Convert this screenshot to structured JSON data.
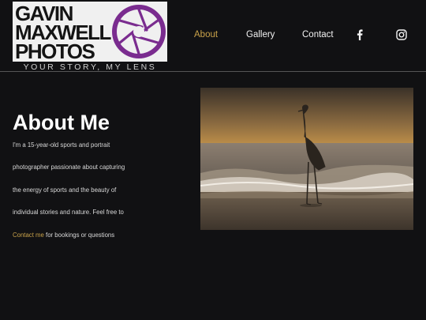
{
  "logo": {
    "lines": [
      "GAVIN",
      "MAXWELL",
      "PHOTOS"
    ],
    "tagline": "YOUR STORY, MY LENS",
    "accent_color": "#7a2c8f"
  },
  "nav": {
    "items": [
      {
        "label": "About",
        "active": true
      },
      {
        "label": "Gallery",
        "active": false
      },
      {
        "label": "Contact",
        "active": false
      }
    ],
    "active_color": "#c9a24a",
    "social_icons": [
      "facebook-icon",
      "instagram-icon"
    ]
  },
  "main": {
    "title": "About Me",
    "bio_prefix": "I'm a 15-year-old sports and portrait photographer passionate about capturing the energy of sports and the beauty of individual stories and nature. Feel free to ",
    "bio_link": "Contact me",
    "bio_suffix": " for bookings or questions"
  },
  "photo": {
    "subject": "heron standing on beach at sunset"
  }
}
